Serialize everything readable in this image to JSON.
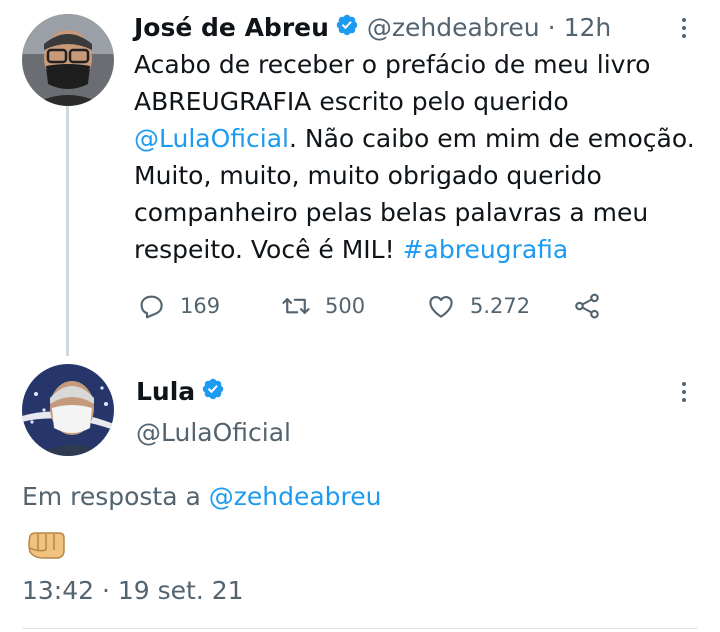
{
  "tweet1": {
    "name": "José de Abreu",
    "handle": "@zehdeabreu",
    "separator": "·",
    "time": "12h",
    "text_line1": "Acabo de receber o prefácio de meu livro",
    "text_line2": "ABREUGRAFIA escrito pelo querido",
    "mention": "@LulaOficial",
    "text_line3_rest": ". Não caibo em mim de emoção.",
    "text_line4": "Muito, muito, muito obrigado querido",
    "text_line5": "companheiro pelas belas palavras a meu",
    "text_line6_start": "respeito. Você é MIL! ",
    "hashtag": "#abreugrafia",
    "replies": "169",
    "retweets": "500",
    "likes": "5.272"
  },
  "tweet2": {
    "name": "Lula",
    "handle": "@LulaOficial",
    "reply_prefix": "Em resposta a ",
    "reply_to": "@zehdeabreu",
    "emoji": "fist-emoji",
    "timestamp": "13:42 · 19 set. 21"
  },
  "colors": {
    "accent": "#1d9bf0",
    "muted": "#536471",
    "text": "#0f1419",
    "divider": "#cfd9de"
  }
}
